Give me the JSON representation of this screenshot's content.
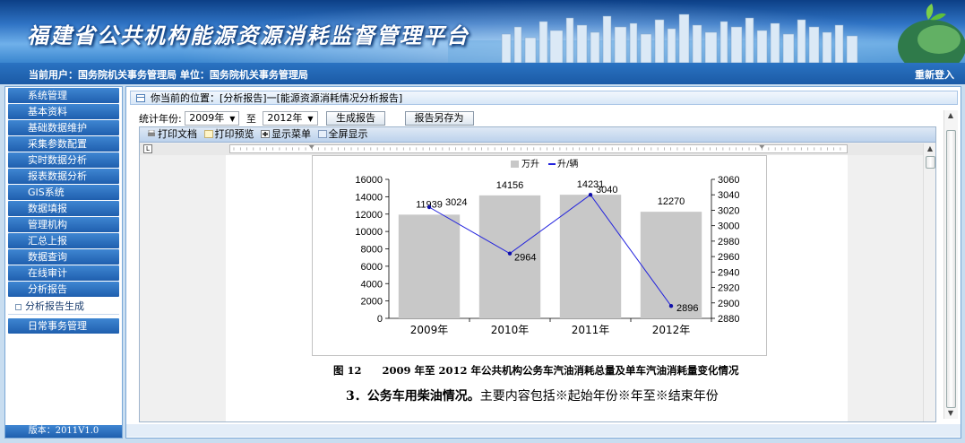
{
  "banner": {
    "title": "福建省公共机构能源资源消耗监督管理平台"
  },
  "userbar": {
    "user_text": "当前用户：国务院机关事务管理局  单位：国务院机关事务管理局",
    "relogin": "重新登入"
  },
  "nav": {
    "items": [
      {
        "label": "系统管理"
      },
      {
        "label": "基本资料"
      },
      {
        "label": "基础数据维护"
      },
      {
        "label": "采集参数配置"
      },
      {
        "label": "实时数据分析"
      },
      {
        "label": "报表数据分析"
      },
      {
        "label": "GIS系统"
      },
      {
        "label": "数据填报"
      },
      {
        "label": "管理机构"
      },
      {
        "label": "汇总上报"
      },
      {
        "label": "数据查询"
      },
      {
        "label": "在线审计"
      },
      {
        "label": "分析报告"
      }
    ],
    "sub_item": "分析报告生成",
    "after_item": "日常事务管理",
    "version": "版本：2011V1.0"
  },
  "main": {
    "breadcrumb": "你当前的位置：[分析报告]一[能源资源消耗情况分析报告]",
    "year_label": "统计年份:",
    "year_from": "2009年",
    "to_label": "至",
    "year_to": "2012年",
    "generate_btn": "生成报告",
    "saveas_btn": "报告另存为",
    "print_doc": "打印文档",
    "print_preview": "打印预览",
    "show_menu": "显示菜单",
    "fullscreen": "全屏显示",
    "caption": "图 12　　2009 年至 2012 年公共机构公务车汽油消耗总量及单车汽油消耗量变化情况",
    "section3_bold": "3．公务车用柴油情况。",
    "section3_text": "主要内容包括※起始年份※年至※结束年份"
  },
  "chart_data": {
    "type": "bar",
    "categories": [
      "2009年",
      "2010年",
      "2011年",
      "2012年"
    ],
    "series": [
      {
        "name": "万升",
        "type": "bar",
        "axis": "left",
        "values": [
          11939,
          14156,
          14231,
          12270
        ],
        "color": "#c8c8c8"
      },
      {
        "name": "升/辆",
        "type": "line",
        "axis": "right",
        "values": [
          3024,
          2964,
          3040,
          2896
        ],
        "color": "#2222dd"
      }
    ],
    "y_left": {
      "min": 0,
      "max": 16000,
      "ticks": [
        0,
        2000,
        4000,
        6000,
        8000,
        10000,
        12000,
        14000,
        16000
      ]
    },
    "y_right": {
      "min": 2880,
      "max": 3060,
      "ticks": [
        2880,
        2900,
        2920,
        2940,
        2960,
        2980,
        3000,
        3020,
        3040,
        3060
      ]
    },
    "legend_position": "top-center",
    "grid": false
  },
  "colors": {
    "nav_blue": "#1f5fae",
    "banner_blue": "#2f73c4",
    "line_blue": "#2222dd"
  }
}
